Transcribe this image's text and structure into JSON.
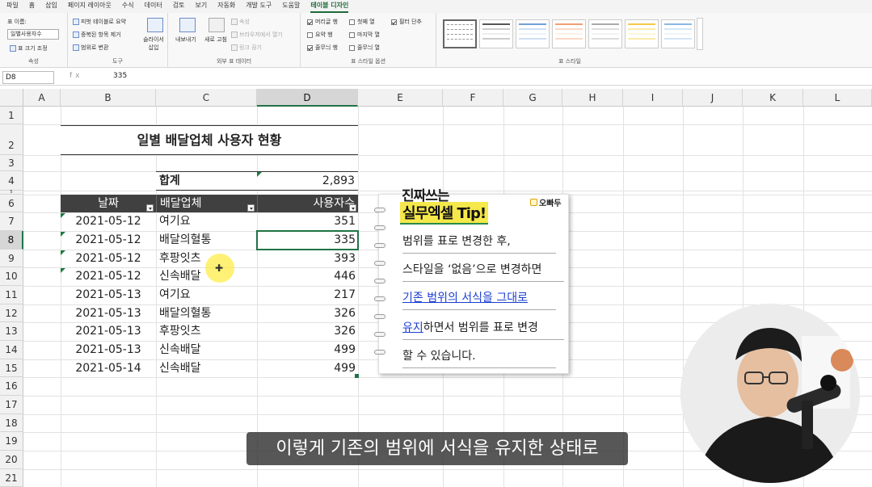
{
  "ribbon_tabs": [
    "파일",
    "홈",
    "삽입",
    "페이지 레이아웃",
    "수식",
    "데이터",
    "검토",
    "보기",
    "자동화",
    "개발 도구",
    "도움말",
    "테이블 디자인"
  ],
  "ribbon": {
    "props": {
      "name_label": "표 이름:",
      "name_value": "일별사용자수",
      "resize": "표 크기 조정",
      "group": "속성"
    },
    "tools": {
      "pivot": "피벗 테이블로 요약",
      "dedupe": "중복된 항목 제거",
      "convert": "범위로 변환",
      "slicer": "슬라이서 삽입",
      "group": "도구"
    },
    "external": {
      "export": "내보내기",
      "refresh": "새로 고침",
      "properties": "속성",
      "browser": "브라우저에서 열기",
      "unlink": "링크 끊기",
      "group": "외부 표 데이터"
    },
    "options": {
      "header_row": "머리글 행",
      "total_row": "요약 행",
      "banded_rows": "줄무늬 행",
      "first_col": "첫째 열",
      "last_col": "마지막 열",
      "banded_cols": "줄무늬 열",
      "filter_btn": "필터 단추",
      "group": "표 스타일 옵션"
    },
    "styles": {
      "group": "표 스타일"
    }
  },
  "formula_bar": {
    "name_box": "D8",
    "fx": "fx",
    "value": "335"
  },
  "columns": [
    "A",
    "B",
    "C",
    "D",
    "E",
    "F",
    "G",
    "H",
    "I",
    "J",
    "K",
    "L"
  ],
  "rows": [
    "1",
    "2",
    "3",
    "4",
    "5",
    "6",
    "7",
    "8",
    "9",
    "10",
    "11",
    "12",
    "13",
    "14",
    "15",
    "16",
    "17",
    "18",
    "19",
    "20",
    "21"
  ],
  "sheet": {
    "title": "일별 배달업체 사용자 현황",
    "total_label": "합계",
    "total_value": "2,893",
    "headers": [
      "날짜",
      "배달업체",
      "사용자수"
    ],
    "data": [
      [
        "2021-05-12",
        "여기요",
        "351"
      ],
      [
        "2021-05-12",
        "배달의혈통",
        "335"
      ],
      [
        "2021-05-12",
        "후팡잇츠",
        "393"
      ],
      [
        "2021-05-12",
        "신속배달",
        "446"
      ],
      [
        "2021-05-13",
        "여기요",
        "217"
      ],
      [
        "2021-05-13",
        "배달의혈통",
        "326"
      ],
      [
        "2021-05-13",
        "후팡잇츠",
        "326"
      ],
      [
        "2021-05-13",
        "신속배달",
        "499"
      ],
      [
        "2021-05-14",
        "신속배달",
        "499"
      ]
    ]
  },
  "tip_card": {
    "title1": "진짜쓰는",
    "title2": "실무엑셀 Tip!",
    "brand": "오빠두",
    "lines": [
      "범위를 표로 변경한 후,",
      "스타일을 ‘없음’으로 변경하면",
      "기존 범위의 서식을 그대로",
      "하면서 범위를 표로 변경",
      "할 수 있습니다."
    ],
    "line4_highlight": "유지"
  },
  "subtitle": "이렇게 기존의 범위에 서식을 유지한 상태로",
  "colors": {
    "accent": "#217346",
    "table_header": "#404040",
    "link_blue": "#1c3fd1"
  }
}
